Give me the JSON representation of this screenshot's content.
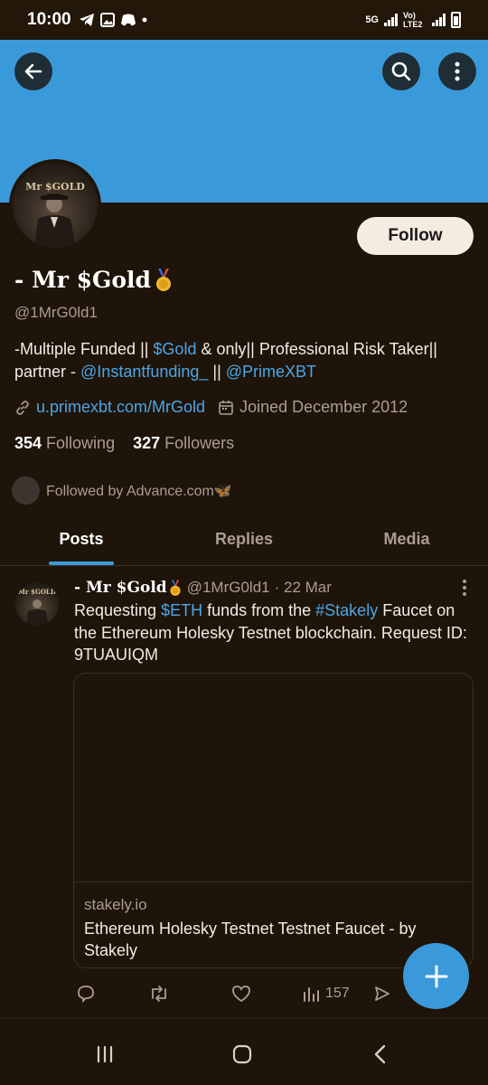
{
  "status_bar": {
    "time": "10:00",
    "network_label": "5G",
    "lte_label": "Vo) LTE2"
  },
  "profile": {
    "avatar_text": "Mr $GOLD",
    "follow_label": "Follow",
    "display_name": "- Mr $Gold",
    "handle": "@1MrG0ld1",
    "bio": {
      "part1": "-Multiple Funded || ",
      "cashtag": "$Gold",
      "part2": " & only|| Professional Risk Taker|| partner - ",
      "mention1": "@Instantfunding_",
      "sep": " || ",
      "mention2": "@PrimeXBT"
    },
    "website": "u.primexbt.com/MrGold",
    "joined": "Joined December 2012",
    "following_count": "354",
    "following_label": "Following",
    "followers_count": "327",
    "followers_label": "Followers",
    "followed_by": "Followed by Advance.com🦋"
  },
  "tabs": [
    {
      "label": "Posts",
      "active": true
    },
    {
      "label": "Replies",
      "active": false
    },
    {
      "label": "Media",
      "active": false
    }
  ],
  "post": {
    "avatar_text": "Mr $GOLD",
    "author": "- Mr $Gold",
    "handle": "@1MrG0ld1",
    "date": "· 22 Mar",
    "text_part1": "Requesting ",
    "cashtag": "$ETH",
    "text_part2": " funds from the ",
    "hashtag": "#Stakely",
    "text_part3": " Faucet on the Ethereum Holesky Testnet blockchain. Request ID: 9TUAUIQM",
    "card_domain": "stakely.io",
    "card_title": "Ethereum Holesky Testnet Testnet Faucet - by Stakely",
    "views": "157"
  },
  "colors": {
    "accent": "#3a9ad9",
    "background": "#1f1409",
    "muted": "#aa9e92",
    "link": "#4aa6e8"
  }
}
